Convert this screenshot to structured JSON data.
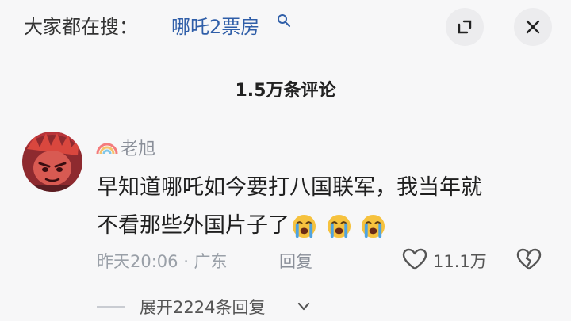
{
  "search": {
    "prefix": "大家都在搜：",
    "term": "哪吒2票房"
  },
  "header": {
    "comment_count_title": "1.5万条评论"
  },
  "comment": {
    "username": "老旭",
    "text_line1": "早知道哪吒如今要打八国联军，我当年就",
    "text_line2": "不看那些外国片子了",
    "emojis": [
      "crying-face",
      "crying-face",
      "crying-face"
    ],
    "time_location": "昨天20:06 · 广东",
    "reply_label": "回复",
    "like_count": "11.1万"
  },
  "replies": {
    "expand_label": "展开2224条回复"
  },
  "colors": {
    "link_blue": "#2f5ea8",
    "meta_gray": "#9aa0a8",
    "background": "#f7f7f8"
  }
}
